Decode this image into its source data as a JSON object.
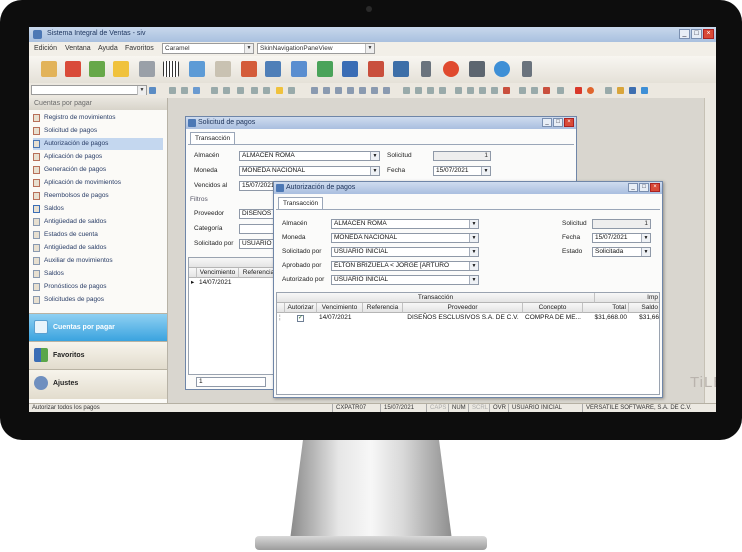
{
  "app": {
    "title": "Sistema Integral de Ventas - siv",
    "menus": [
      "Edición",
      "Ventana",
      "Ayuda",
      "Favoritos"
    ],
    "theme_combo": "Caramel",
    "skin_combo": "SkinNavigationPaneView"
  },
  "sidebar": {
    "header": "Cuentas por pagar",
    "items": [
      "Registro de movimientos",
      "Solicitud de pagos",
      "Autorización de pagos",
      "Aplicación de pagos",
      "Generación de pagos",
      "Aplicación de movimientos",
      "Reembolsos de pagos",
      "Saldos",
      "Antigüedad de saldos",
      "Estados de cuenta",
      "Antigüedad de saldos",
      "Auxiliar de movimientos",
      "Saldos",
      "Pronósticos de pagos",
      "Solicitudes de pagos"
    ],
    "selected_index": 2,
    "panes": [
      "Cuentas por pagar",
      "Favoritos",
      "Ajustes"
    ]
  },
  "solicitud": {
    "title": "Solicitud de pagos",
    "tab": "Transacción",
    "almacen_label": "Almacén",
    "almacen": "ALMACEN ROMA",
    "solicitud_label": "Solicitud",
    "solicitud": "1",
    "moneda_label": "Moneda",
    "moneda": "MONEDA NACIONAL",
    "fecha_label": "Fecha",
    "fecha": "15/07/2021",
    "vencidos_label": "Vencidos al",
    "vencidos": "15/07/2021",
    "filtros_label": "Filtros",
    "proveedor_label": "Proveedor",
    "proveedor": "DISEÑOS",
    "categoria_label": "Categoría",
    "solicitado_label": "Solicitado por",
    "solicitado": "USUARIO",
    "grid_headers": [
      "Vencimiento",
      "Referencia"
    ],
    "grid_row_date": "14/07/2021",
    "footer_value": "1"
  },
  "autorizacion": {
    "title": "Autorización de pagos",
    "tab": "Transacción",
    "almacen_label": "Almacén",
    "almacen": "ALMACEN ROMA",
    "solicitud_label": "Solicitud",
    "solicitud": "1",
    "moneda_label": "Moneda",
    "moneda": "MONEDA NACIONAL",
    "fecha_label": "Fecha",
    "fecha": "15/07/2021",
    "solicitado_label": "Solicitado por",
    "solicitado": "USUARIO INICIAL",
    "estado_label": "Estado",
    "estado": "Solicitada",
    "aprobado_label": "Aprobado por",
    "aprobado": "ELTON BRIZUELA < JORGE [ARTURO",
    "autorizado_label": "Autorizado por",
    "autorizado": "USUARIO INICIAL",
    "group_transaccion": "Transacción",
    "group_imp": "Imp",
    "headers": [
      "Autorizar",
      "Vencimiento",
      "Referencia",
      "Proveedor",
      "Concepto",
      "Total",
      "Saldo"
    ],
    "row": {
      "vencimiento": "14/07/2021",
      "referencia": "",
      "proveedor": "DISEÑOS ESCLUSIVOS S.A. DE C.V.",
      "concepto": "COMPRA DE ME...",
      "total": "$31,668.00",
      "saldo": "$31,66"
    }
  },
  "watermark": "TiLE",
  "status": {
    "message": "Autorizar todos los pagos",
    "machine": "CXPATR07",
    "date": "15/07/2021",
    "caps": "CAPS",
    "num": "NUM",
    "scrl": "SCRL",
    "ovr": "OVR",
    "user": "USUARIO INICIAL",
    "company": "VERSATILE SOFTWARE, S.A. DE C.V."
  }
}
